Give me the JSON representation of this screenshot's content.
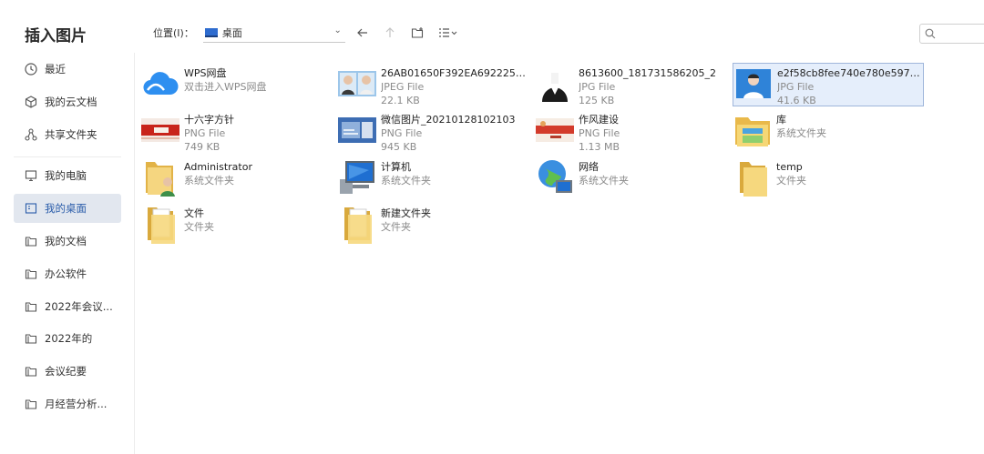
{
  "dialog": {
    "title": "插入图片"
  },
  "toolbar": {
    "location_label": "位置(I)：",
    "location_value": "桌面"
  },
  "sidebar": {
    "items": [
      {
        "label": "最近",
        "icon": "clock-icon"
      },
      {
        "label": "我的云文档",
        "icon": "cube-icon"
      },
      {
        "label": "共享文件夹",
        "icon": "share-icon"
      },
      {
        "label": "我的电脑",
        "icon": "monitor-icon"
      },
      {
        "label": "我的桌面",
        "icon": "desktop-icon",
        "active": true
      },
      {
        "label": "我的文档",
        "icon": "folder-outline-icon"
      },
      {
        "label": "办公软件",
        "icon": "folder-outline-icon"
      },
      {
        "label": "2022年会议...",
        "icon": "folder-outline-icon"
      },
      {
        "label": "2022年的",
        "icon": "folder-outline-icon"
      },
      {
        "label": "会议纪要",
        "icon": "folder-outline-icon"
      },
      {
        "label": "月经营分析...",
        "icon": "folder-outline-icon"
      }
    ]
  },
  "files": [
    {
      "name": "WPS网盘",
      "line2": "双击进入WPS网盘",
      "line3": "",
      "icon": "cloud-icon"
    },
    {
      "name": "26AB01650F392EA692225EB...",
      "line2": "JPEG File",
      "line3": "22.1 KB",
      "icon": "photo-thumb"
    },
    {
      "name": "8613600_181731586205_2",
      "line2": "JPG File",
      "line3": "125 KB",
      "icon": "photo-thumb"
    },
    {
      "name": "e2f58cb8fee740e780e59727c...",
      "line2": "JPG File",
      "line3": "41.6 KB",
      "icon": "photo-thumb",
      "selected": true
    },
    {
      "name": "十六字方针",
      "line2": "PNG File",
      "line3": "749 KB",
      "icon": "banner-thumb"
    },
    {
      "name": "微信图片_20210128102103",
      "line2": "PNG File",
      "line3": "945 KB",
      "icon": "photo-thumb"
    },
    {
      "name": "作风建设",
      "line2": "PNG File",
      "line3": "1.13 MB",
      "icon": "banner-thumb"
    },
    {
      "name": "库",
      "line2": "系统文件夹",
      "line3": "",
      "icon": "library-folder-icon"
    },
    {
      "name": "Administrator",
      "line2": "系统文件夹",
      "line3": "",
      "icon": "user-folder-icon"
    },
    {
      "name": "计算机",
      "line2": "系统文件夹",
      "line3": "",
      "icon": "computer-icon"
    },
    {
      "name": "网络",
      "line2": "系统文件夹",
      "line3": "",
      "icon": "network-globe-icon"
    },
    {
      "name": "temp",
      "line2": "文件夹",
      "line3": "",
      "icon": "folder-icon"
    },
    {
      "name": "文件",
      "line2": "文件夹",
      "line3": "",
      "icon": "folder-icon"
    },
    {
      "name": "新建文件夹",
      "line2": "文件夹",
      "line3": "",
      "icon": "folder-icon"
    }
  ],
  "colors": {
    "accent": "#2a5caa",
    "selected_bg": "#e5eefb",
    "active_nav_bg": "#e2e7ef"
  }
}
